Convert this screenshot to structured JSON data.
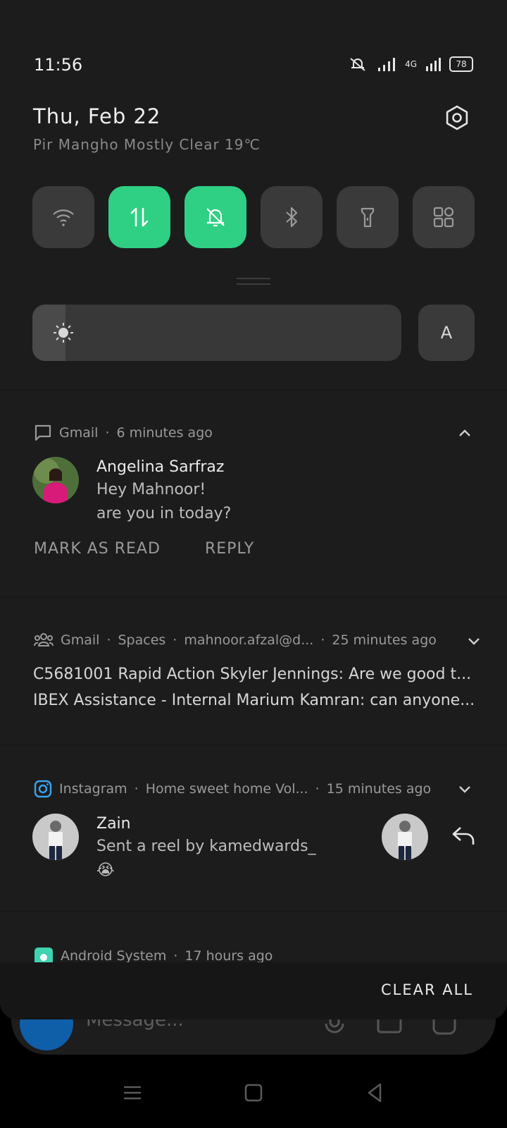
{
  "status_bar": {
    "time": "11:56",
    "network": "4G",
    "battery": "78"
  },
  "header": {
    "date": "Thu, Feb 22",
    "weather": "Pir Mangho Mostly Clear 19℃"
  },
  "quick_tiles": [
    {
      "name": "wifi",
      "active": false
    },
    {
      "name": "mobile-data",
      "active": true
    },
    {
      "name": "do-not-disturb",
      "active": true
    },
    {
      "name": "bluetooth",
      "active": false
    },
    {
      "name": "flashlight",
      "active": false
    },
    {
      "name": "more-apps",
      "active": false
    }
  ],
  "brightness": {
    "level": 0.09,
    "auto_label": "A"
  },
  "colors": {
    "accent": "#2fd084",
    "shade_bg": "#1c1c1c",
    "tile_bg": "#3a3a3a"
  },
  "notifications": {
    "gmail_chat": {
      "app": "Gmail",
      "time": "6 minutes ago",
      "sender": "Angelina Sarfraz",
      "line1": "Hey Mahnoor!",
      "line2": "are you in today?",
      "action1": "MARK AS READ",
      "action2": "REPLY"
    },
    "gmail_spaces": {
      "app": "Gmail",
      "sub": "Spaces",
      "account": "mahnoor.afzal@d...",
      "time": "25 minutes ago",
      "line1": "C5681001 Rapid Action Skyler Jennings: Are we good t...",
      "line2": "IBEX Assistance - Internal Marium Kamran: can anyone..."
    },
    "instagram": {
      "app": "Instagram",
      "sub": "Home sweet home Vol...",
      "time": "15 minutes ago",
      "sender": "Zain",
      "line1": "Sent a reel by kamedwards_",
      "emoji": "😭"
    },
    "android": {
      "app": "Android System",
      "time": "17 hours ago"
    }
  },
  "clear_all": "CLEAR ALL",
  "background_app": {
    "compose_placeholder": "Message..."
  }
}
